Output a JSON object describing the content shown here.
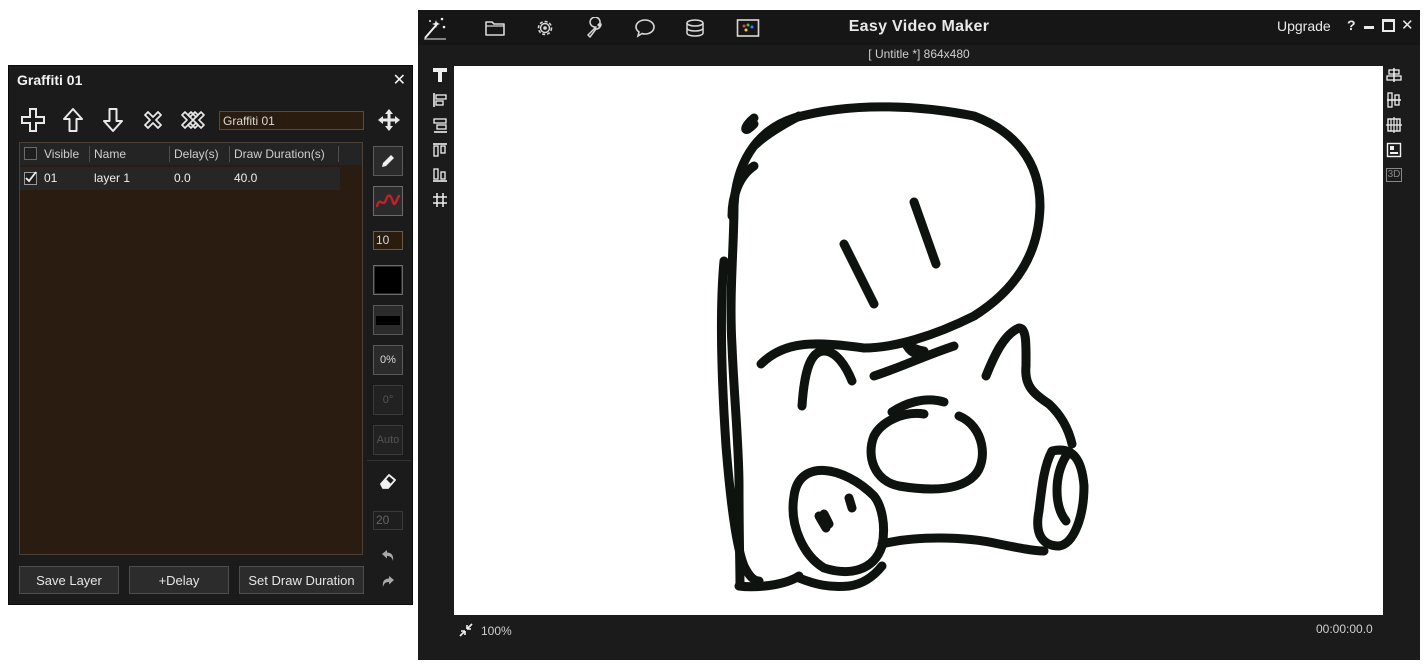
{
  "graffiti_panel": {
    "title": "Graffiti 01",
    "close_symbol": "✕",
    "name_value": "Graffiti 01",
    "toolbar_icons": [
      "add-icon",
      "move-up-icon",
      "move-down-icon",
      "delete-icon",
      "delete-all-icon",
      "move-tool-icon"
    ],
    "columns": [
      "Visible",
      "Name",
      "Delay(s)",
      "Draw Duration(s)"
    ],
    "layers": [
      {
        "index": "01",
        "name": "layer 1",
        "delay": "0.0",
        "duration": "40.0",
        "visible": true
      }
    ],
    "brush_size": "10",
    "opacity": "0%",
    "rotation": "0°",
    "auto_label": "Auto",
    "eraser_size": "20",
    "brush_color": "#000000",
    "stroke_color": "#c0202c",
    "buttons": {
      "save_layer": "Save Layer",
      "delay": "+Delay",
      "set_draw_duration": "Set Draw Duration"
    }
  },
  "editor": {
    "app_title": "Easy Video Maker",
    "upgrade_label": "Upgrade",
    "help_symbol": "?",
    "document_title": "[ Untitle *]  864x480",
    "zoom": "100%",
    "timecode": "00:00:00.0",
    "toolbar_icons": [
      "magic-wand-icon",
      "folder-icon",
      "settings-gear-icon",
      "wrench-icon",
      "speech-bubble-icon",
      "database-icon",
      "palette-image-icon"
    ],
    "left_tools": [
      "text-tool-icon",
      "align-left-icon",
      "align-right-icon",
      "align-top-icon",
      "align-bottom-icon",
      "grid-icon"
    ],
    "right_tools": [
      "distribute-horizontal-icon",
      "distribute-vertical-icon",
      "center-grid-icon",
      "layout-icon"
    ],
    "right_3d_label": "3D"
  }
}
